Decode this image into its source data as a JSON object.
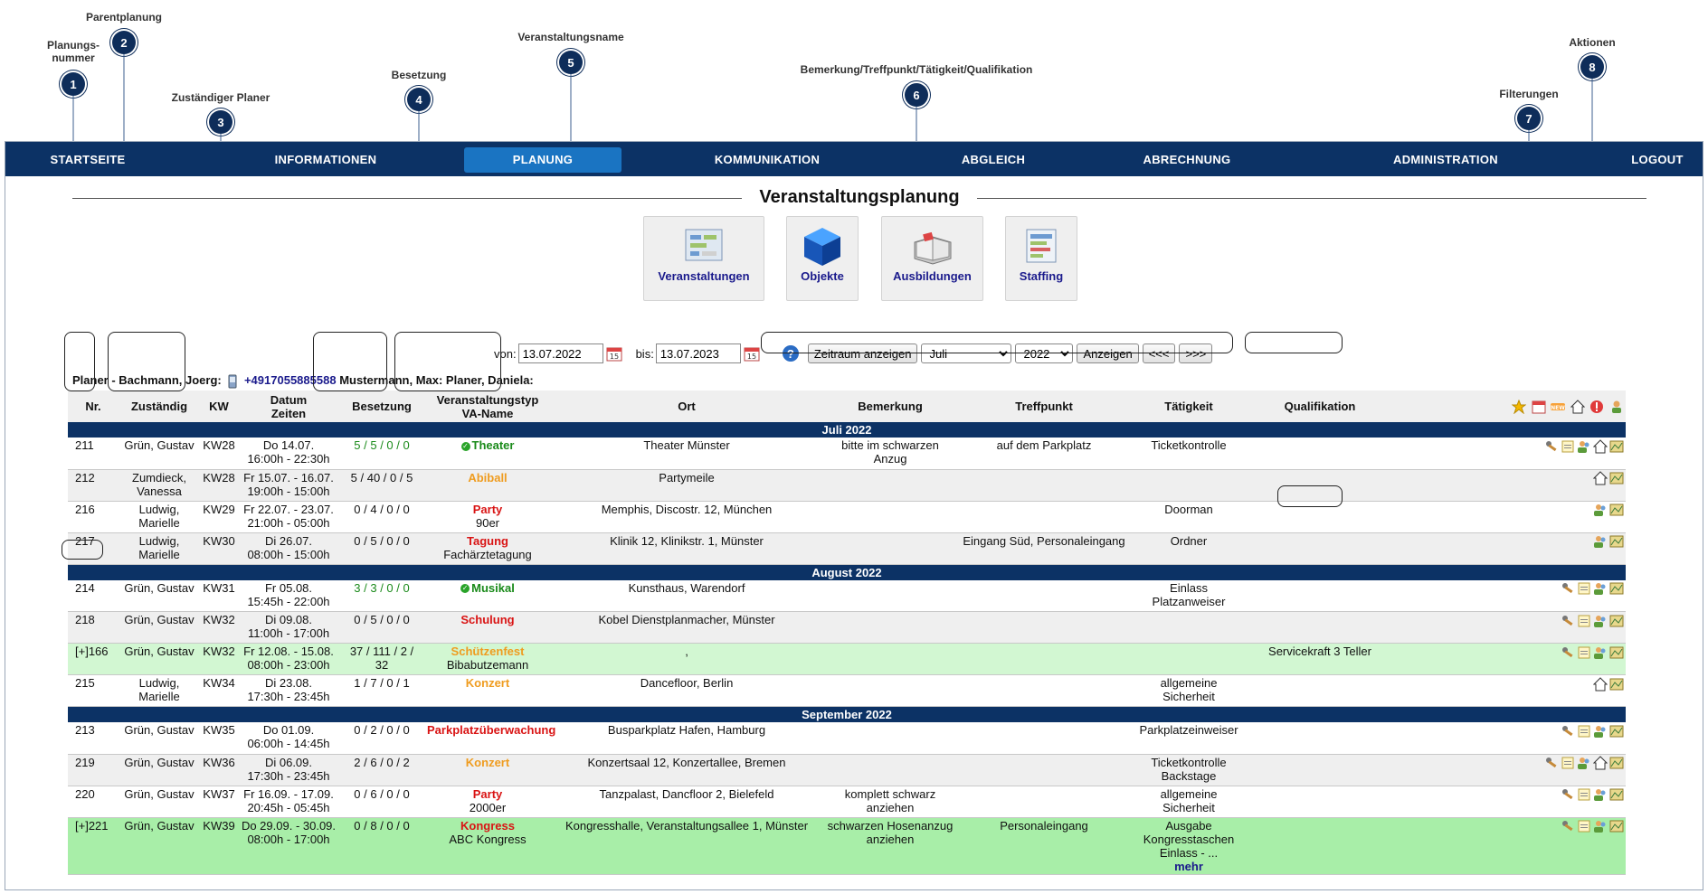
{
  "callouts": [
    {
      "num": "1",
      "label": "Planungs-\nnummer"
    },
    {
      "num": "2",
      "label": "Parentplanung"
    },
    {
      "num": "3",
      "label": "Zuständiger Planer"
    },
    {
      "num": "4",
      "label": "Besetzung"
    },
    {
      "num": "5",
      "label": "Veranstaltungsname"
    },
    {
      "num": "6",
      "label": "Bemerkung/Treffpunkt/Tätigkeit/Qualifikation"
    },
    {
      "num": "7",
      "label": "Filterungen"
    },
    {
      "num": "8",
      "label": "Aktionen"
    }
  ],
  "nav": {
    "items": [
      "STARTSEITE",
      "INFORMATIONEN",
      "PLANUNG",
      "KOMMUNIKATION",
      "ABGLEICH",
      "ABRECHNUNG",
      "ADMINISTRATION",
      "LOGOUT"
    ],
    "active": "PLANUNG"
  },
  "page_title": "Veranstaltungsplanung",
  "tiles": [
    "Veranstaltungen",
    "Objekte",
    "Ausbildungen",
    "Staffing"
  ],
  "filter": {
    "von_label": "von:",
    "von_value": "13.07.2022",
    "bis_label": "bis:",
    "bis_value": "13.07.2023",
    "zeitraum_button": "Zeitraum anzeigen",
    "month_value": "Juli",
    "year_value": "2022",
    "anzeigen_button": "Anzeigen",
    "prev_button": "<<<",
    "next_button": ">>>"
  },
  "planer": {
    "prefix": "Planer - Bachmann, Joerg:",
    "phone": "+4917055885588",
    "others": "Mustermann, Max:  Planer, Daniela:"
  },
  "table": {
    "headers": {
      "nr": "Nr.",
      "zustaendig": "Zuständig",
      "kw": "KW",
      "datum": "Datum",
      "zeiten": "Zeiten",
      "besetzung": "Besetzung",
      "typ": "Veranstaltungstyp",
      "va_name": "VA-Name",
      "ort": "Ort",
      "bemerkung": "Bemerkung",
      "treffpunkt": "Treffpunkt",
      "taetigkeit": "Tätigkeit",
      "qualifikation": "Qualifikation"
    },
    "months": [
      "Juli 2022",
      "August 2022",
      "September 2022"
    ],
    "rows": [
      {
        "nr": "211",
        "zust": "Grün, Gustav",
        "kw": "KW28",
        "datum": "Do 14.07.",
        "zeit": "16:00h - 22:30h",
        "bes": "5 / 5 / 0 / 0",
        "typ": "Theater",
        "name": "",
        "ort": "Theater Münster",
        "bem": "bitte im schwarzen Anzug",
        "treff": "auf dem Parkplatz",
        "taet": "Ticketkontrolle",
        "qual": ""
      },
      {
        "nr": "212",
        "zust": "Zumdieck, Vanessa",
        "kw": "KW28",
        "datum": "Fr 15.07. - 16.07.",
        "zeit": "19:00h - 15:00h",
        "bes": "5 / 40 / 0 / 5",
        "typ": "Abiball",
        "name": "",
        "ort": "Partymeile",
        "bem": "",
        "treff": "",
        "taet": "",
        "qual": ""
      },
      {
        "nr": "216",
        "zust": "Ludwig, Marielle",
        "kw": "KW29",
        "datum": "Fr 22.07. - 23.07.",
        "zeit": "21:00h - 05:00h",
        "bes": "0 / 4 / 0 / 0",
        "typ": "Party",
        "name": "90er",
        "ort": "Memphis, Discostr. 12, München",
        "bem": "",
        "treff": "",
        "taet": "Doorman",
        "qual": ""
      },
      {
        "nr": "217",
        "zust": "Ludwig, Marielle",
        "kw": "KW30",
        "datum": "Di 26.07.",
        "zeit": "08:00h - 15:00h",
        "bes": "0 / 5 / 0 / 0",
        "typ": "Tagung",
        "name": "Fachärztetagung",
        "ort": "Klinik 12, Klinikstr. 1, Münster",
        "bem": "",
        "treff": "Eingang Süd, Personaleingang",
        "taet": "Ordner",
        "qual": ""
      },
      {
        "nr": "214",
        "zust": "Grün, Gustav",
        "kw": "KW31",
        "datum": "Fr 05.08.",
        "zeit": "15:45h - 22:00h",
        "bes": "3 / 3 / 0 / 0",
        "typ": "Musikal",
        "name": "",
        "ort": "Kunsthaus, Warendorf",
        "bem": "",
        "treff": "",
        "taet": "Einlass Platzanweiser",
        "qual": ""
      },
      {
        "nr": "218",
        "zust": "Grün, Gustav",
        "kw": "KW32",
        "datum": "Di 09.08.",
        "zeit": "11:00h - 17:00h",
        "bes": "0 / 5 / 0 / 0",
        "typ": "Schulung",
        "name": "",
        "ort": "Kobel Dienstplanmacher, Münster",
        "bem": "",
        "treff": "",
        "taet": "",
        "qual": ""
      },
      {
        "nr": "[+]166",
        "zust": "Grün, Gustav",
        "kw": "KW32",
        "datum": "Fr 12.08. - 15.08.",
        "zeit": "08:00h - 23:00h",
        "bes": "37 / 111 / 2 / 32",
        "typ": "Schützenfest",
        "name": "Bibabutzemann",
        "ort": ",",
        "bem": "",
        "treff": "",
        "taet": "",
        "qual": "Servicekraft 3 Teller"
      },
      {
        "nr": "215",
        "zust": "Ludwig, Marielle",
        "kw": "KW34",
        "datum": "Di 23.08.",
        "zeit": "17:30h - 23:45h",
        "bes": "1 / 7 / 0 / 1",
        "typ": "Konzert",
        "name": "",
        "ort": "Dancefloor, Berlin",
        "bem": "",
        "treff": "",
        "taet": "allgemeine Sicherheit",
        "qual": ""
      },
      {
        "nr": "213",
        "zust": "Grün, Gustav",
        "kw": "KW35",
        "datum": "Do 01.09.",
        "zeit": "06:00h - 14:45h",
        "bes": "0 / 2 / 0 / 0",
        "typ": "Parkplatzüberwachung",
        "name": "",
        "ort": "Busparkplatz Hafen, Hamburg",
        "bem": "",
        "treff": "",
        "taet": "Parkplatzeinweiser",
        "qual": ""
      },
      {
        "nr": "219",
        "zust": "Grün, Gustav",
        "kw": "KW36",
        "datum": "Di 06.09.",
        "zeit": "17:30h - 23:45h",
        "bes": "2 / 6 / 0 / 2",
        "typ": "Konzert",
        "name": "",
        "ort": "Konzertsaal 12, Konzertallee, Bremen",
        "bem": "",
        "treff": "",
        "taet": "Ticketkontrolle Backstage",
        "qual": ""
      },
      {
        "nr": "220",
        "zust": "Grün, Gustav",
        "kw": "KW37",
        "datum": "Fr 16.09. - 17.09.",
        "zeit": "20:45h - 05:45h",
        "bes": "0 / 6 / 0 / 0",
        "typ": "Party",
        "name": "2000er",
        "ort": "Tanzpalast, Dancfloor 2, Bielefeld",
        "bem": "komplett schwarz anziehen",
        "treff": "",
        "taet": "allgemeine Sicherheit",
        "qual": ""
      },
      {
        "nr": "[+]221",
        "zust": "Grün, Gustav",
        "kw": "KW39",
        "datum": "Do 29.09. - 30.09.",
        "zeit": "08:00h - 17:00h",
        "bes": "0 / 8 / 0 / 0",
        "typ": "Kongress",
        "name": "ABC Kongress",
        "ort": "Kongresshalle, Veranstaltungsallee 1, Münster",
        "bem": "schwarzen Hosenanzug anziehen",
        "treff": "Personaleingang",
        "taet": "Ausgabe Kongresstaschen Einlass - ...",
        "qual": "",
        "more": "mehr"
      }
    ]
  },
  "colors": {
    "nav_bg": "#0c3265",
    "nav_active": "#1a74c2",
    "ok_green": "#1a8a1a",
    "orange": "#ef9c1f",
    "red": "#d91414",
    "row_green": "#d2f7d2"
  },
  "icons": [
    "star-icon",
    "calendar-icon",
    "new-icon",
    "home-icon",
    "warning-icon",
    "user-group-icon",
    "edit-icon",
    "document-icon",
    "map-icon"
  ]
}
